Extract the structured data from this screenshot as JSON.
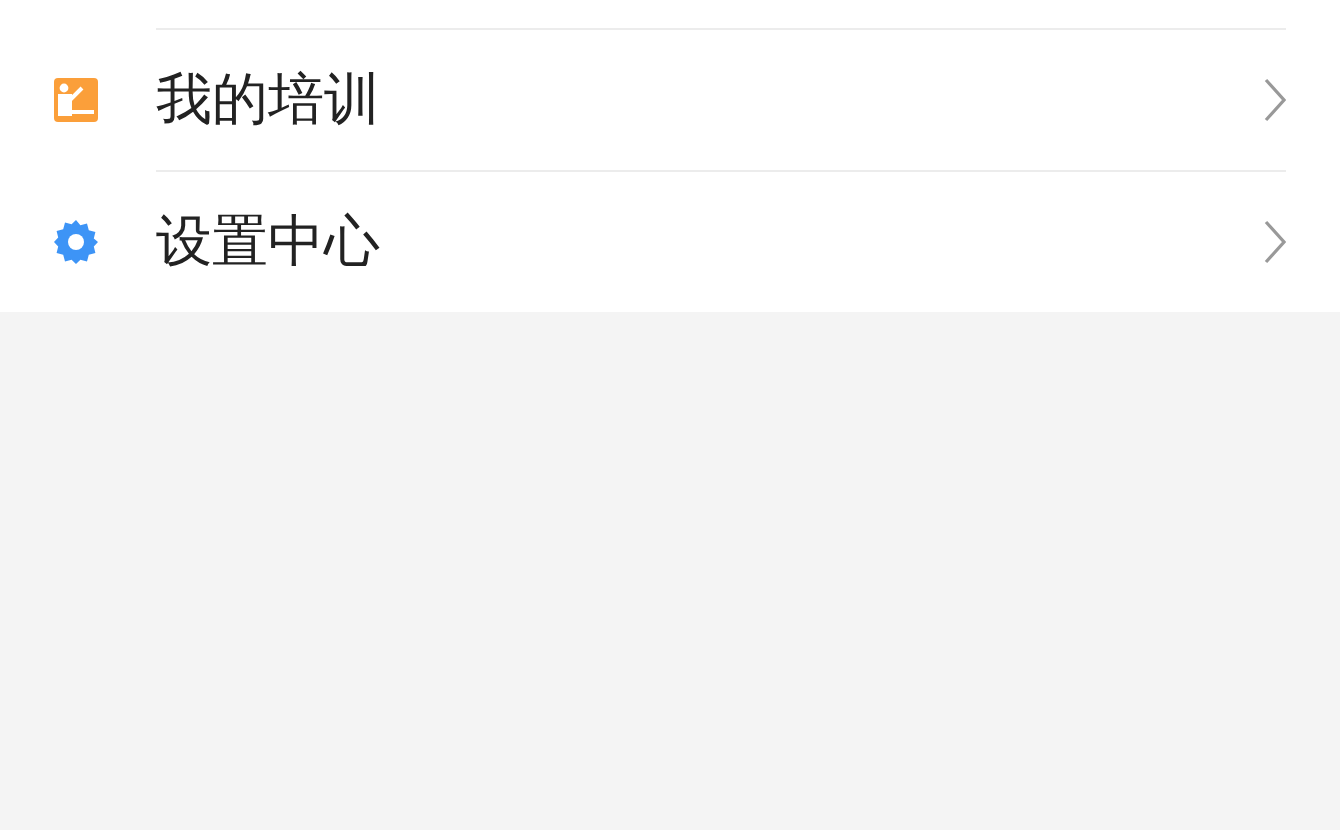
{
  "menu": [
    {
      "kind": "training",
      "label": "我的培训"
    },
    {
      "kind": "settings",
      "label": "设置中心"
    }
  ]
}
